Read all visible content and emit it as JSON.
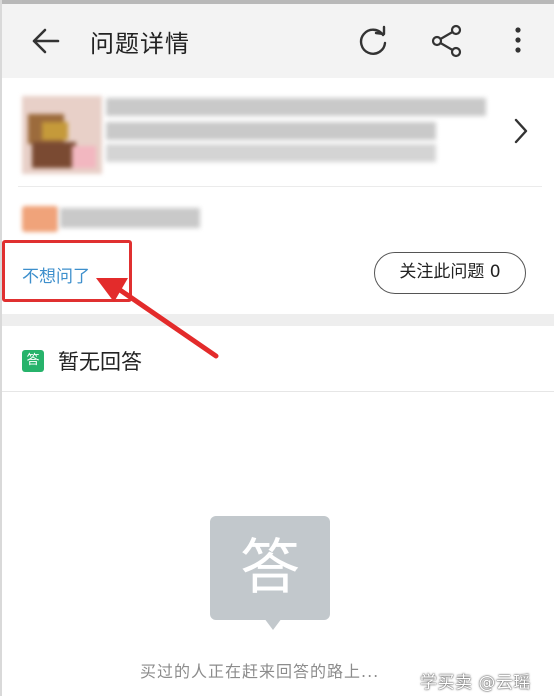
{
  "header": {
    "title": "问题详情",
    "back_icon": "arrow-left-icon",
    "refresh_icon": "refresh-icon",
    "share_icon": "share-icon",
    "more_icon": "more-vertical-icon"
  },
  "question": {
    "cancel_label": "不想问了",
    "follow_label": "关注此问题 0"
  },
  "answers": {
    "badge": "答",
    "title": "暂无回答",
    "empty_glyph": "答",
    "empty_message": "买过的人正在赶来回答的路上..."
  },
  "watermark": "学买卖 @云瑶",
  "colors": {
    "link": "#3d8fcc",
    "badge": "#27b36b",
    "highlight": "#e03030"
  }
}
